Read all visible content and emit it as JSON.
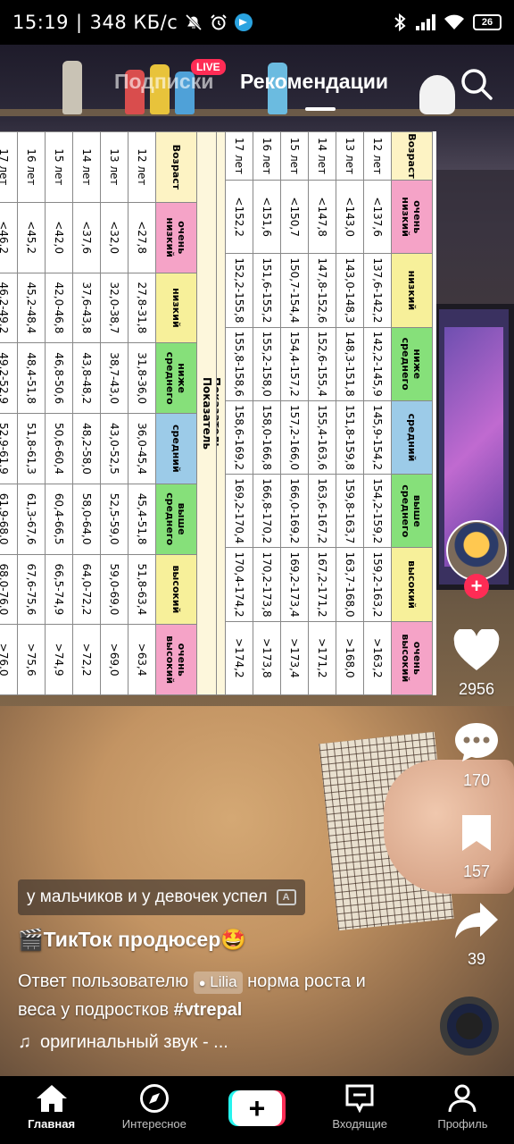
{
  "status_bar": {
    "time": "15:19",
    "separator": "|",
    "network_speed": "348 КБ/с",
    "battery": "26"
  },
  "top_tabs": {
    "following": "Подписки",
    "live_badge": "LIVE",
    "for_you": "Рекомендации"
  },
  "table": {
    "pokazatel": "Показатель",
    "height": {
      "headers": [
        "Возраст",
        "очень низкий",
        "низкий",
        "ниже среднего",
        "средний",
        "выше среднего",
        "высокий",
        "очень высокий"
      ],
      "rows": [
        [
          "12 лет",
          "<137,6",
          "137,6-142,2",
          "142,2-145,9",
          "145,9-154,2",
          "154,2-159,2",
          "159,2-163,2",
          ">163,2"
        ],
        [
          "13 лет",
          "<143,0",
          "143,0-148,3",
          "148,3-151,8",
          "151,8-159,8",
          "159,8-163,7",
          "163,7-168,0",
          ">168,0"
        ],
        [
          "14 лет",
          "<147,8",
          "147,8-152,6",
          "152,6-155,4",
          "155,4-163,6",
          "163,6-167,2",
          "167,2-171,2",
          ">171,2"
        ],
        [
          "15 лет",
          "<150,7",
          "150,7-154,4",
          "154,4-157,2",
          "157,2-166,0",
          "166,0-169,2",
          "169,2-173,4",
          ">173,4"
        ],
        [
          "16 лет",
          "<151,6",
          "151,6-155,2",
          "155,2-158,0",
          "158,0-166,8",
          "166,8-170,2",
          "170,2-173,8",
          ">173,8"
        ],
        [
          "17 лет",
          "<152,2",
          "152,2-155,8",
          "155,8-158,6",
          "158,6-169,2",
          "169,2-170,4",
          "170,4-174,2",
          ">174,2"
        ]
      ]
    },
    "weight": {
      "headers": [
        "Возраст",
        "очень низкий",
        "низкий",
        "ниже среднего",
        "средний",
        "выше среднего",
        "высокий",
        "очень высокий"
      ],
      "rows": [
        [
          "12 лет",
          "<27,8",
          "27,8-31,8",
          "31,8-36,0",
          "36,0-45,4",
          "45,4-51,8",
          "51,8-63,4",
          ">63,4"
        ],
        [
          "13 лет",
          "<32,0",
          "32,0-38,7",
          "38,7-43,0",
          "43,0-52,5",
          "52,5-59,0",
          "59,0-69,0",
          ">69,0"
        ],
        [
          "14 лет",
          "<37,6",
          "37,6-43,8",
          "43,8-48,2",
          "48,2-58,0",
          "58,0-64,0",
          "64,0-72,2",
          ">72,2"
        ],
        [
          "15 лет",
          "<42,0",
          "42,0-46,8",
          "46,8-50,6",
          "50,6-60,4",
          "60,4-66,5",
          "66,5-74,9",
          ">74,9"
        ],
        [
          "16 лет",
          "<45,2",
          "45,2-48,4",
          "48,4-51,8",
          "51,8-61,3",
          "61,3-67,6",
          "67,6-75,6",
          ">75,6"
        ],
        [
          "17 лет",
          "<46,2",
          "46,2-49,2",
          "49,2-52,9",
          "52,9-61,9",
          "61,9-68,0",
          "68,0-76,0",
          ">76,0"
        ]
      ]
    }
  },
  "actions": {
    "likes": "2956",
    "comments": "170",
    "saves": "157",
    "shares": "39"
  },
  "caption": {
    "subtitle": "у мальчиков и у девочек успел",
    "cc_label": "A",
    "username": "🎬ТикТок продюсер🤩",
    "reply_prefix": "Ответ пользователю",
    "mention": "Lilia",
    "reply_text": "норма роста и веса у подростков",
    "hashtag": "#vtrepal",
    "sound": "оригинальный звук - ..."
  },
  "bottom_nav": {
    "home": "Главная",
    "discover": "Интересное",
    "create": "+",
    "inbox": "Входящие",
    "profile": "Профиль"
  },
  "colors": {
    "accent_red": "#fe2c55",
    "accent_cyan": "#25f4ee"
  }
}
